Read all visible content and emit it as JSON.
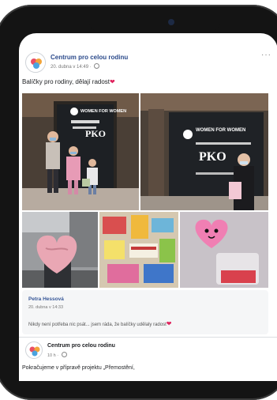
{
  "post": {
    "author": "Centrum pro celou rodinu",
    "timestamp": "20. dubna v 14:49 ·",
    "more_label": "···",
    "text": "Balíčky pro rodiny, dělají radost",
    "text_emoji": "❤"
  },
  "photos": {
    "sign_women": "WOMEN FOR WOMEN",
    "sign_pko": "PKO",
    "sign_women_2": "WOMEN FOR WOMEN",
    "sign_pko_2": "PKO"
  },
  "comment": {
    "author": "Petra Hessová",
    "timestamp": "20. dubna v 14:33",
    "text": "Nikdy není potřeba nic psát... jsem ráda, že balíčky udělaly radost",
    "text_emoji": "❤"
  },
  "post2": {
    "author": "Centrum pro celou rodinu",
    "timestamp": "10 h ·",
    "text": "Pokračujeme v přípravě projektu „Přemostění,"
  },
  "colors": {
    "link_blue": "#2b4a8b",
    "heart_red": "#e0245e",
    "frame": "#141414"
  }
}
